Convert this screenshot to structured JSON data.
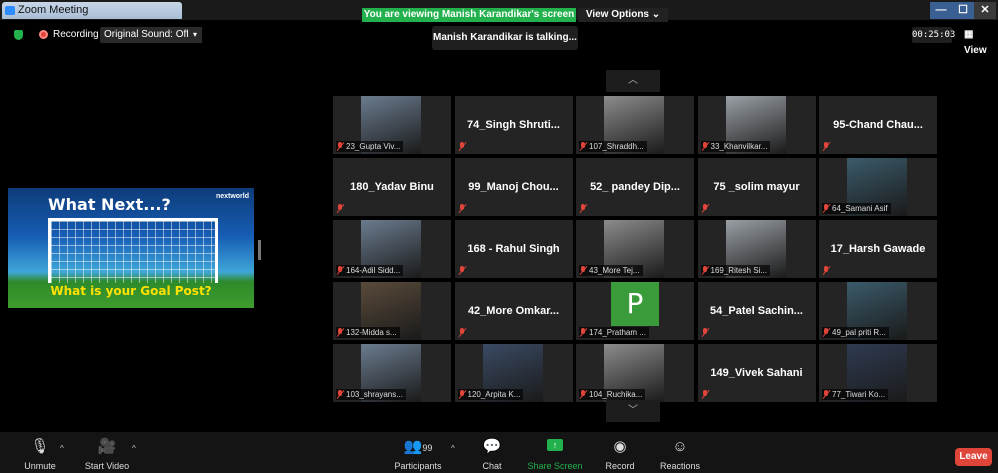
{
  "window": {
    "title": "Zoom Meeting",
    "viewing_banner": "You are viewing Manish Karandikar's screen",
    "view_options": "View Options ⌄",
    "controls": [
      "—",
      "☐",
      "✕"
    ]
  },
  "topbar": {
    "recording_label": "Recording",
    "original_sound": "Original Sound: Off",
    "talking": "Manish Karandikar is talking...",
    "timer": "00:25:03",
    "view_label": "View"
  },
  "shared_screen": {
    "slide_title": "What Next...?",
    "logo": "nextworld",
    "caption": "What is your Goal Post?"
  },
  "gallery": {
    "tiles": [
      {
        "kind": "photo",
        "label": "23_Gupta Viv..."
      },
      {
        "kind": "name",
        "text": "74_Singh  Shruti..."
      },
      {
        "kind": "photo",
        "label": "107_Shraddh..."
      },
      {
        "kind": "photo",
        "label": "33_Khanvilkar..."
      },
      {
        "kind": "name",
        "text": "95-Chand  Chau..."
      },
      {
        "kind": "name",
        "text": "180_Yadav Binu"
      },
      {
        "kind": "name",
        "text": "99_Manoj  Chou..."
      },
      {
        "kind": "name",
        "text": "52_ pandey  Dip..."
      },
      {
        "kind": "name",
        "text": "75 _solim mayur"
      },
      {
        "kind": "photo",
        "label": "64_Samani Asif"
      },
      {
        "kind": "photo",
        "label": "164-Adil Sidd..."
      },
      {
        "kind": "name",
        "text": "168 - Rahul Singh"
      },
      {
        "kind": "photo",
        "label": "43_More Tej..."
      },
      {
        "kind": "photo",
        "label": "169_Ritesh Si..."
      },
      {
        "kind": "name",
        "text": "17_Harsh Gawade"
      },
      {
        "kind": "photo",
        "label": "132-Midda s..."
      },
      {
        "kind": "name",
        "text": "42_More  Omkar..."
      },
      {
        "kind": "avatar",
        "letter": "P",
        "label": "174_Pratham ..."
      },
      {
        "kind": "name",
        "text": "54_Patel  Sachin..."
      },
      {
        "kind": "photo",
        "label": "49_pal priti R..."
      },
      {
        "kind": "photo",
        "label": "103_shrayans..."
      },
      {
        "kind": "photo",
        "label": "120_Arpita K..."
      },
      {
        "kind": "photo",
        "label": "104_Ruchika..."
      },
      {
        "kind": "name",
        "text": "149_Vivek Sahani"
      },
      {
        "kind": "photo",
        "label": "77_Tiwari Ko..."
      }
    ]
  },
  "toolbar": {
    "unmute": "Unmute",
    "start_video": "Start Video",
    "participants": "Participants",
    "participants_count": "99",
    "chat": "Chat",
    "share_screen": "Share Screen",
    "record": "Record",
    "reactions": "Reactions",
    "leave": "Leave"
  },
  "colors": {
    "accent_green": "#22b14c",
    "leave_red": "#e0453a",
    "tile_bg": "#242424"
  }
}
